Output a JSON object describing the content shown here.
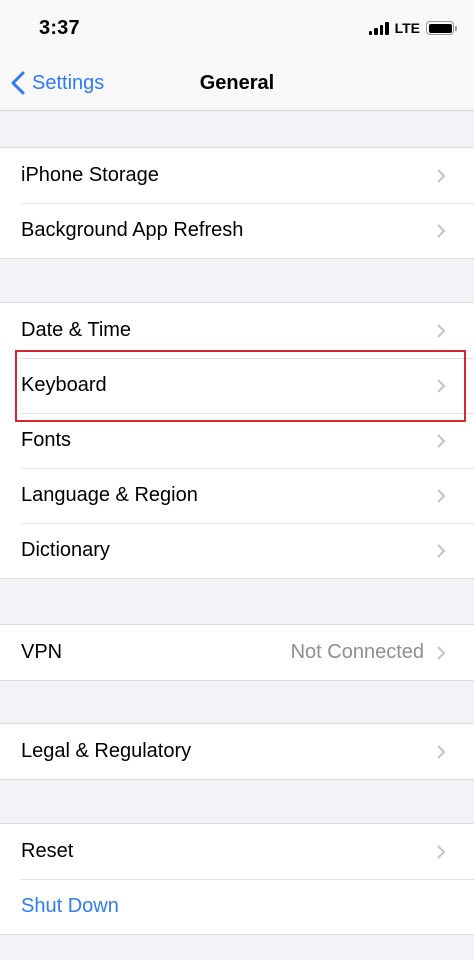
{
  "status_bar": {
    "time": "3:37",
    "network": "LTE"
  },
  "nav_bar": {
    "back_label": "Settings",
    "title": "General"
  },
  "groups": [
    {
      "rows": [
        {
          "label": "iPhone Storage"
        },
        {
          "label": "Background App Refresh"
        }
      ]
    },
    {
      "rows": [
        {
          "label": "Date & Time"
        },
        {
          "label": "Keyboard"
        },
        {
          "label": "Fonts"
        },
        {
          "label": "Language & Region"
        },
        {
          "label": "Dictionary"
        }
      ]
    },
    {
      "rows": [
        {
          "label": "VPN",
          "value": "Not Connected"
        }
      ]
    },
    {
      "rows": [
        {
          "label": "Legal & Regulatory"
        }
      ]
    },
    {
      "rows": [
        {
          "label": "Reset"
        },
        {
          "label": "Shut Down"
        }
      ]
    }
  ],
  "colors": {
    "accent": "#2f7bf6",
    "highlight": "#d9262e",
    "background": "#f2f2f7"
  }
}
